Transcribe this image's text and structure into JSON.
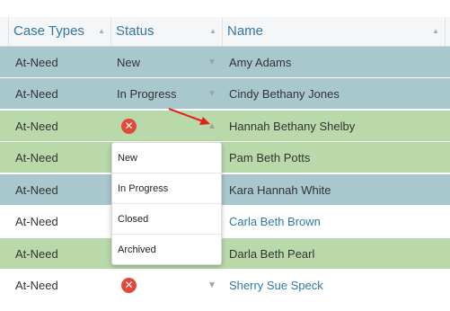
{
  "columns": [
    {
      "label": "Case Types"
    },
    {
      "label": "Status"
    },
    {
      "label": "Name"
    }
  ],
  "rows": [
    {
      "case_type": "At-Need",
      "status": "New",
      "name": "Amy Adams"
    },
    {
      "case_type": "At-Need",
      "status": "In Progress",
      "name": "Cindy Bethany Jones"
    },
    {
      "case_type": "At-Need",
      "status": "",
      "name": "Hannah Bethany Shelby"
    },
    {
      "case_type": "At-Need",
      "status": "",
      "name": "Pam Beth Potts"
    },
    {
      "case_type": "At-Need",
      "status": "",
      "name": "Kara Hannah White"
    },
    {
      "case_type": "At-Need",
      "status": "",
      "name": "Carla Beth Brown"
    },
    {
      "case_type": "At-Need",
      "status": "",
      "name": "Darla Beth Pearl"
    },
    {
      "case_type": "At-Need",
      "status": "",
      "name": "Sherry Sue Speck"
    }
  ],
  "status_dropdown": {
    "options": [
      "New",
      "In Progress",
      "Closed",
      "Archived"
    ]
  },
  "icons": {
    "sort": "sort-up-icon",
    "error": "x-circle-icon",
    "chevron_down": "chevron-down-icon",
    "chevron_up": "chevron-up-icon",
    "annotation": "red-arrow-icon"
  },
  "colors": {
    "row_blue": "#a9c8ce",
    "row_green": "#b9d9aa",
    "row_white": "#ffffff",
    "link": "#2f78ab",
    "error": "#e2493b",
    "arrow": "#e0231c"
  }
}
